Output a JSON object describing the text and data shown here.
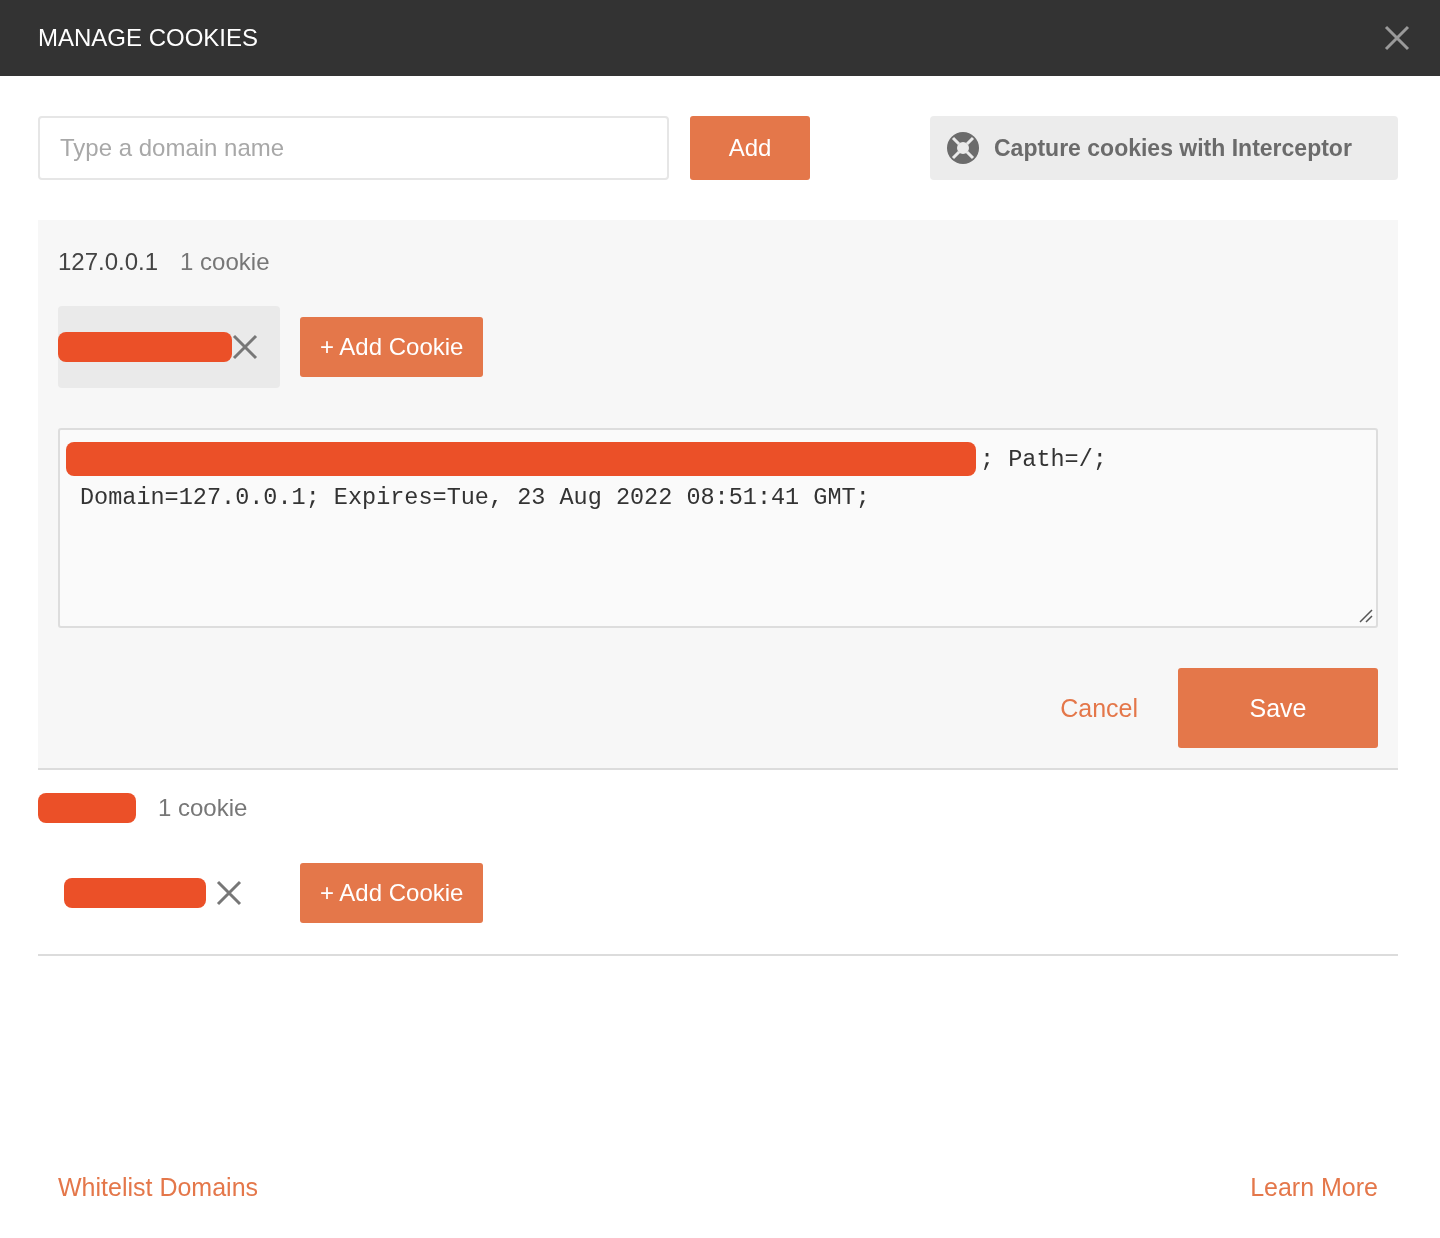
{
  "dialog": {
    "title": "MANAGE COOKIES"
  },
  "domain_field": {
    "placeholder": "Type a domain name"
  },
  "add_button": "Add",
  "interceptor_button": "Capture cookies with Interceptor",
  "domains": [
    {
      "name": "127.0.0.1",
      "count": "1 cookie",
      "expanded": true,
      "cookies": [
        {
          "selected": true
        }
      ],
      "add_label": "+ Add Cookie",
      "editor": {
        "line_1": "; Path=/;",
        "line_2": "Domain=127.0.0.1; Expires=Tue, 23 Aug 2022 08:51:41 GMT;"
      },
      "cancel": "Cancel",
      "save": "Save"
    },
    {
      "count": "1 cookie",
      "expanded": false,
      "cookies": [
        {
          "selected": false
        }
      ],
      "add_label": "+ Add Cookie"
    }
  ],
  "footer": {
    "left_link": "Whitelist Domains",
    "right_link": "Learn More"
  }
}
